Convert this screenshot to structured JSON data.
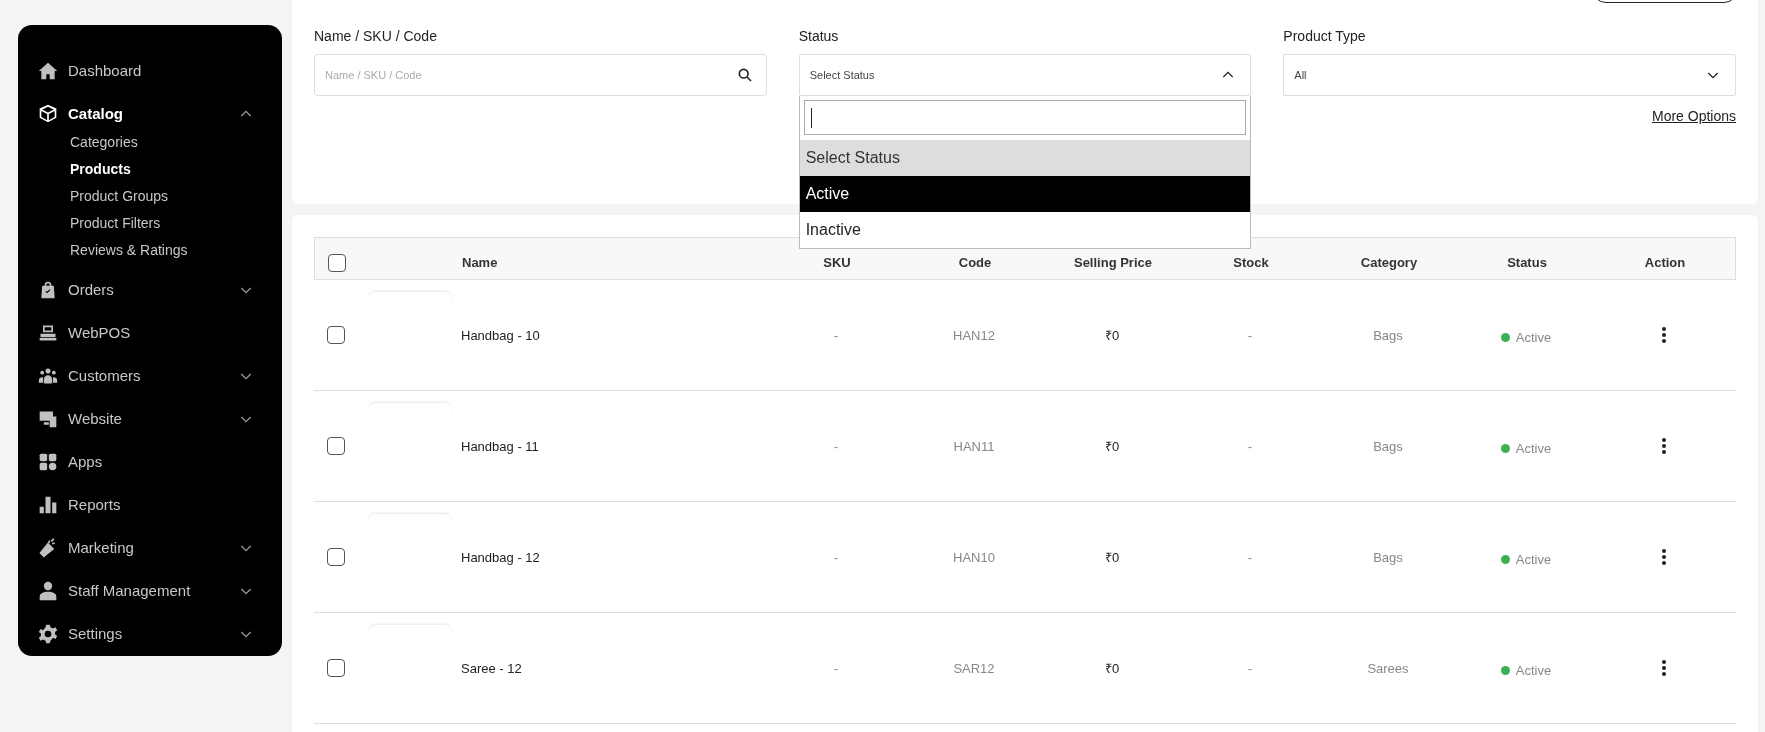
{
  "sidebar": {
    "items": [
      {
        "label": "Dashboard",
        "selected": false
      },
      {
        "label": "Catalog",
        "selected": true,
        "expanded": true,
        "children": [
          {
            "label": "Categories",
            "selected": false
          },
          {
            "label": "Products",
            "selected": true
          },
          {
            "label": "Product Groups",
            "selected": false
          },
          {
            "label": "Product Filters",
            "selected": false
          },
          {
            "label": "Reviews & Ratings",
            "selected": false
          }
        ]
      },
      {
        "label": "Orders",
        "selected": false,
        "expanded": false
      },
      {
        "label": "WebPOS",
        "selected": false
      },
      {
        "label": "Customers",
        "selected": false,
        "expanded": false
      },
      {
        "label": "Website",
        "selected": false,
        "expanded": false
      },
      {
        "label": "Apps",
        "selected": false
      },
      {
        "label": "Reports",
        "selected": false
      },
      {
        "label": "Marketing",
        "selected": false,
        "expanded": false
      },
      {
        "label": "Staff Management",
        "selected": false,
        "expanded": false
      },
      {
        "label": "Settings",
        "selected": false,
        "expanded": false
      }
    ]
  },
  "filters": {
    "name": {
      "label": "Name / SKU / Code",
      "placeholder": "Name / SKU / Code"
    },
    "status": {
      "label": "Status",
      "value": "Select Status",
      "expanded": true,
      "options": [
        {
          "label": "Select Status",
          "selected": true,
          "highlighted": false
        },
        {
          "label": "Active",
          "selected": false,
          "highlighted": true
        },
        {
          "label": "Inactive",
          "selected": false,
          "highlighted": false
        }
      ]
    },
    "product_type": {
      "label": "Product Type",
      "value": "All",
      "expanded": false
    },
    "more_options": "More Options"
  },
  "table": {
    "header_checked": false,
    "columns": [
      "Name",
      "SKU",
      "Code",
      "Selling Price",
      "Stock",
      "Category",
      "Status",
      "Action"
    ],
    "rows": [
      {
        "checked": false,
        "name": "Handbag - 10",
        "sku": "-",
        "code": "HAN12",
        "price": "₹0",
        "stock": "-",
        "category": "Bags",
        "status": "Active"
      },
      {
        "checked": false,
        "name": "Handbag - 11",
        "sku": "-",
        "code": "HAN11",
        "price": "₹0",
        "stock": "-",
        "category": "Bags",
        "status": "Active"
      },
      {
        "checked": false,
        "name": "Handbag - 12",
        "sku": "-",
        "code": "HAN10",
        "price": "₹0",
        "stock": "-",
        "category": "Bags",
        "status": "Active"
      },
      {
        "checked": false,
        "name": "Saree - 12",
        "sku": "-",
        "code": "SAR12",
        "price": "₹0",
        "stock": "-",
        "category": "Sarees",
        "status": "Active"
      }
    ]
  }
}
